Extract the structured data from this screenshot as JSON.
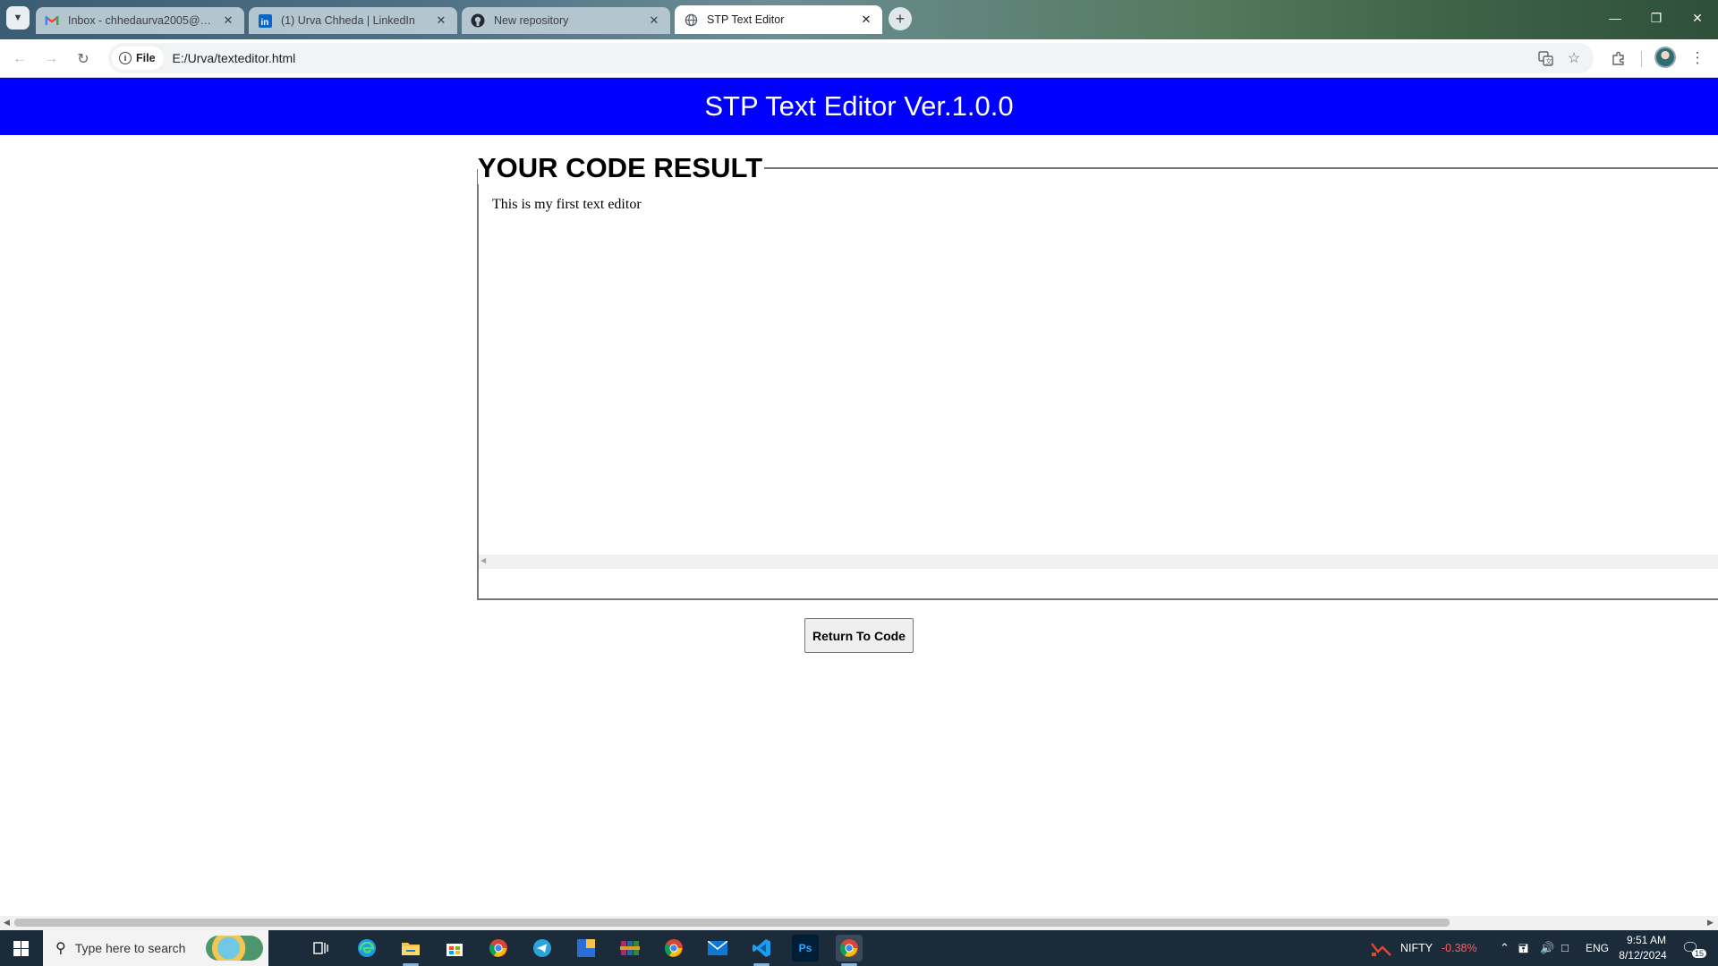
{
  "browser": {
    "tabs": [
      {
        "title": "Inbox - chhedaurva2005@gmail.com",
        "icon": "gmail-icon",
        "active": false
      },
      {
        "title": "(1) Urva Chheda | LinkedIn",
        "icon": "linkedin-icon",
        "active": false
      },
      {
        "title": "New repository",
        "icon": "github-icon",
        "active": false
      },
      {
        "title": "STP Text Editor",
        "icon": "globe-icon",
        "active": true
      }
    ],
    "chip_label": "File",
    "url": "E:/Urva/texteditor.html"
  },
  "page": {
    "header_title": "STP Text Editor Ver.1.0.0",
    "result_title": "YOUR CODE RESULT",
    "result_text": "This is my first text editor",
    "return_button": "Return To Code"
  },
  "taskbar": {
    "search_placeholder": "Type here to search",
    "pinned": [
      "task-view-icon",
      "edge-icon",
      "file-explorer-icon",
      "store-icon",
      "chrome-icon",
      "telegram-icon",
      "app-icon",
      "winrar-icon",
      "chrome-icon",
      "mail-icon",
      "vscode-icon",
      "photoshop-icon",
      "chrome-icon"
    ],
    "ticker_name": "NIFTY",
    "ticker_change": "-0.38%",
    "language": "ENG",
    "time": "9:51 AM",
    "date": "8/12/2024",
    "notifications": "15"
  },
  "colors": {
    "header_bg": "#0000ff",
    "ticker_negative": "#ff5b5b"
  }
}
